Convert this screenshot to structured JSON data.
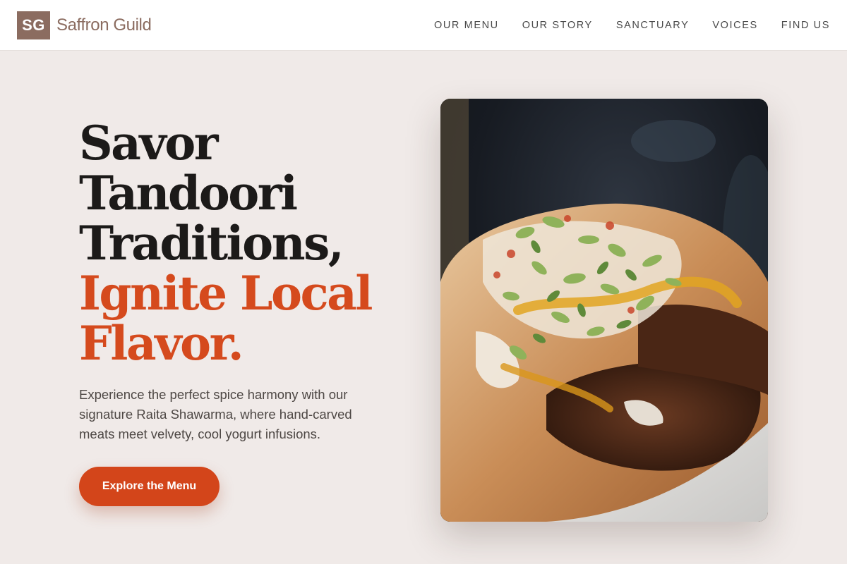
{
  "brand": {
    "initials": "SG",
    "name": "Saffron Guild",
    "color": "#8b6c60"
  },
  "nav": {
    "items": [
      {
        "label": "OUR MENU"
      },
      {
        "label": "OUR STORY"
      },
      {
        "label": "SANCTUARY"
      },
      {
        "label": "VOICES"
      },
      {
        "label": "FIND US"
      }
    ]
  },
  "hero": {
    "title_lines": [
      "Savor",
      "Tandoori",
      "Traditions,"
    ],
    "accent_lines": [
      "Ignite Local",
      "Flavor."
    ],
    "subtitle": "Experience the perfect spice harmony with our signature Raita Shawarma, where hand-carved meats meet velvety, cool yogurt infusions.",
    "cta_label": "Explore the Menu",
    "accent_color": "#d54a1d",
    "image_alt": "Raita shawarma wrap topped with herbs and yogurt sauce"
  }
}
